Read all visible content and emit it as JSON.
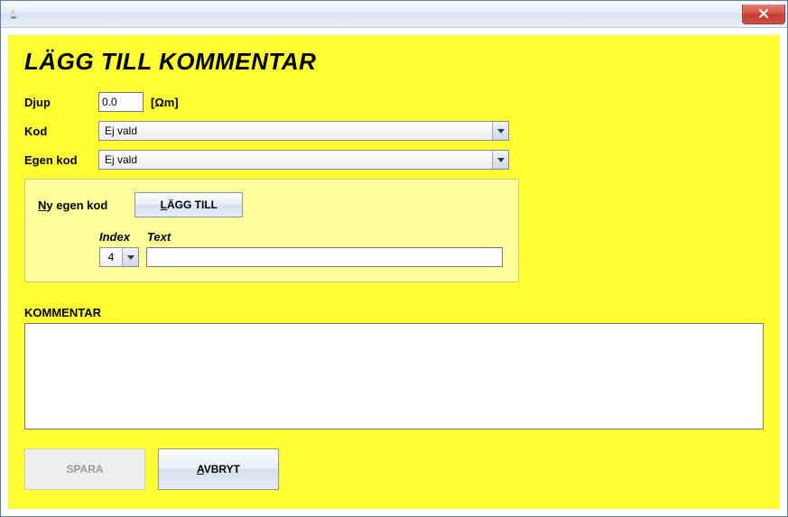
{
  "window": {
    "title": ""
  },
  "header": {
    "title": "LÄGG TILL KOMMENTAR"
  },
  "fields": {
    "depth": {
      "label": "Djup",
      "value": "0.0",
      "unit": "[Ωm]"
    },
    "code": {
      "label": "Kod",
      "selected": "Ej vald"
    },
    "own_code": {
      "label": "Egen kod",
      "selected": "Ej vald"
    }
  },
  "new_code": {
    "label": "Ny egen kod",
    "add_button": "LÄGG TILL",
    "add_button_underline": "L",
    "headers": {
      "index": "Index",
      "text": "Text"
    },
    "index_selected": "4",
    "text_value": ""
  },
  "comment": {
    "label": "KOMMENTAR",
    "value": ""
  },
  "buttons": {
    "save": "SPARA",
    "cancel": "AVBRYT",
    "cancel_underline": "A"
  }
}
